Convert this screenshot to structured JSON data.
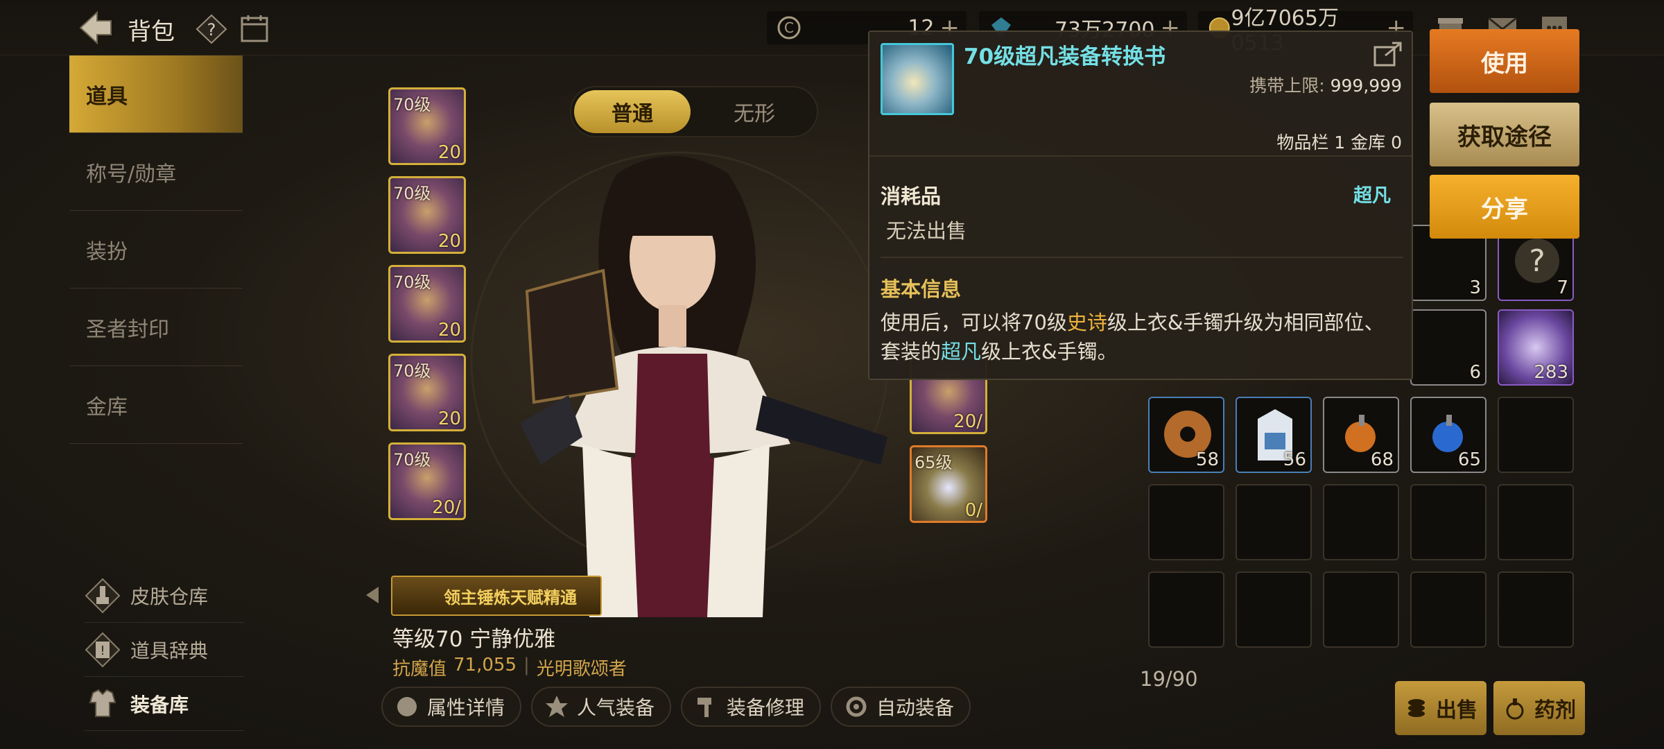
{
  "header": {
    "title": "背包",
    "currencies": [
      {
        "icon": "c-coin-icon",
        "value": "12"
      },
      {
        "icon": "crystal-icon",
        "value": "73万2700"
      },
      {
        "icon": "gold-coin-icon",
        "value": "9亿7065万0513"
      }
    ]
  },
  "nav": {
    "items": [
      {
        "label": "道具",
        "active": true
      },
      {
        "label": "称号/勋章"
      },
      {
        "label": "装扮"
      },
      {
        "label": "圣者封印"
      },
      {
        "label": "金库"
      }
    ]
  },
  "tools": {
    "skin": "皮肤仓库",
    "dict": "道具辞典",
    "equip": "装备库"
  },
  "tabs": {
    "normal": "普通",
    "invisible": "无形"
  },
  "gear_left": [
    {
      "lvl": "70级",
      "count": "20"
    },
    {
      "lvl": "70级",
      "count": "20"
    },
    {
      "lvl": "70级",
      "count": "20"
    },
    {
      "lvl": "70级",
      "count": "20"
    },
    {
      "lvl": "70级",
      "count": "20/"
    }
  ],
  "gear_right": [
    {
      "lvl": "",
      "count": "20/"
    },
    {
      "lvl": "65级",
      "count": "0/"
    }
  ],
  "character": {
    "banner": "领主锤炼天赋精通",
    "name": "等级70 宁静优雅",
    "stat_label": "抗魔值",
    "stat_value": "71,055",
    "title": "光明歌颂者"
  },
  "actions": {
    "attr": "属性详情",
    "popular": "人气装备",
    "repair": "装备修理",
    "auto": "自动装备"
  },
  "inventory": {
    "upper_row1": [
      {
        "count": "3"
      },
      {
        "count": "7"
      }
    ],
    "upper_row2": [
      {
        "count": "6"
      },
      {
        "count": "283"
      }
    ],
    "row1": [
      {
        "count": "58"
      },
      {
        "count": "56"
      },
      {
        "count": "68"
      },
      {
        "count": "65"
      },
      {
        "count": ""
      }
    ],
    "capacity": "19/90",
    "sell": "出售",
    "potion": "药剂"
  },
  "tooltip": {
    "name": "70级超凡装备转换书",
    "limit_label": "携带上限:",
    "limit_value": "999,999",
    "stock": "物品栏 1 金库 0",
    "category": "消耗品",
    "grade": "超凡",
    "sell": "无法出售",
    "section": "基本信息",
    "desc_1": "使用后，可以将70级",
    "desc_epic": "史诗",
    "desc_2": "级上衣&手镯升级为相同部位、套装的",
    "desc_super": "超凡",
    "desc_3": "级上衣&手镯。"
  },
  "buttons": {
    "use": "使用",
    "route": "获取途径",
    "share": "分享"
  }
}
